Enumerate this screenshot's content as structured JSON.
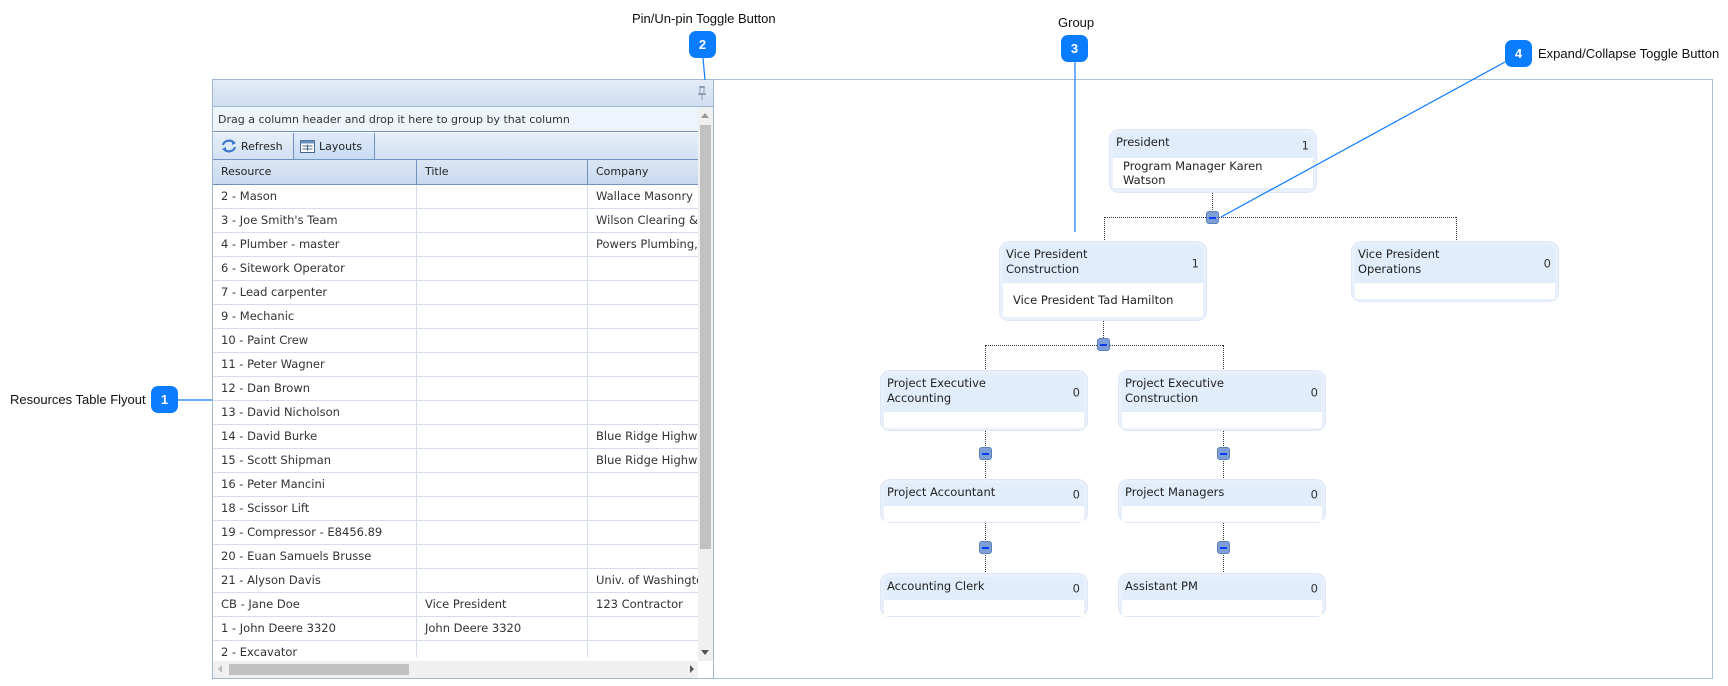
{
  "annotations": [
    {
      "number": "1",
      "label": "Resources Table Flyout"
    },
    {
      "number": "2",
      "label": "Pin/Un-pin Toggle Button"
    },
    {
      "number": "3",
      "label": "Group"
    },
    {
      "number": "4",
      "label": "Expand/Collapse Toggle Button"
    }
  ],
  "accent_color": "#0a7cff",
  "panel": {
    "pin_icon": "pushpin-icon",
    "group_hint": "Drag a column header and drop it here to group by that column",
    "toolbar": {
      "refresh_label": "Refresh",
      "layouts_label": "Layouts"
    },
    "columns": [
      "Resource",
      "Title",
      "Company"
    ],
    "rows": [
      {
        "resource": "2 - Mason",
        "title": "",
        "company": "Wallace Masonry"
      },
      {
        "resource": "3 - Joe Smith's Team",
        "title": "",
        "company": "Wilson Clearing & D"
      },
      {
        "resource": "4 - Plumber - master",
        "title": "",
        "company": "Powers Plumbing, In"
      },
      {
        "resource": "6 - Sitework Operator",
        "title": "",
        "company": ""
      },
      {
        "resource": "7 - Lead carpenter",
        "title": "",
        "company": ""
      },
      {
        "resource": "9 - Mechanic",
        "title": "",
        "company": ""
      },
      {
        "resource": "10 - Paint Crew",
        "title": "",
        "company": ""
      },
      {
        "resource": "11 - Peter Wagner",
        "title": "",
        "company": ""
      },
      {
        "resource": "12 - Dan Brown",
        "title": "",
        "company": ""
      },
      {
        "resource": "13 - David Nicholson",
        "title": "",
        "company": ""
      },
      {
        "resource": "14 - David Burke",
        "title": "",
        "company": "Blue Ridge Highway"
      },
      {
        "resource": "15 - Scott Shipman",
        "title": "",
        "company": "Blue Ridge Highway"
      },
      {
        "resource": "16 - Peter Mancini",
        "title": "",
        "company": ""
      },
      {
        "resource": "18 - Scissor Lift",
        "title": "",
        "company": ""
      },
      {
        "resource": "19 - Compressor - E8456.89",
        "title": "",
        "company": ""
      },
      {
        "resource": "20 - Euan Samuels Brusse",
        "title": "",
        "company": ""
      },
      {
        "resource": "21 - Alyson Davis",
        "title": "",
        "company": "Univ. of Washington"
      },
      {
        "resource": "CB - Jane Doe",
        "title": "Vice President",
        "company": "123 Contractor"
      },
      {
        "resource": "1 - John Deere 3320",
        "title": "John Deere 3320",
        "company": ""
      },
      {
        "resource": "2 - Excavator",
        "title": "",
        "company": ""
      }
    ]
  },
  "org_chart": {
    "nodes": {
      "president": {
        "title": "President",
        "count": "1",
        "member": "Program Manager Karen Watson"
      },
      "vp_construction": {
        "title": "Vice President Construction",
        "count": "1",
        "member": "Vice President Tad Hamilton"
      },
      "vp_operations": {
        "title": "Vice President Operations",
        "count": "0",
        "member": ""
      },
      "pe_accounting": {
        "title": "Project Executive Accounting",
        "count": "0",
        "member": ""
      },
      "pe_construction": {
        "title": "Project Executive Construction",
        "count": "0",
        "member": ""
      },
      "project_accountant": {
        "title": "Project Accountant",
        "count": "0",
        "member": ""
      },
      "project_managers": {
        "title": "Project Managers",
        "count": "0",
        "member": ""
      },
      "accounting_clerk": {
        "title": "Accounting Clerk",
        "count": "0",
        "member": ""
      },
      "assistant_pm": {
        "title": "Assistant PM",
        "count": "0",
        "member": ""
      }
    }
  }
}
